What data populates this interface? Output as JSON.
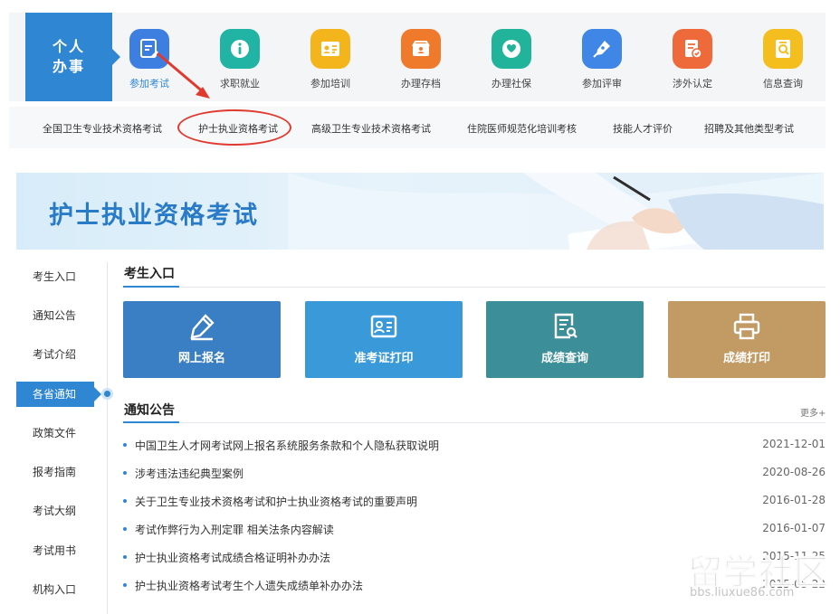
{
  "top_nav": {
    "personal_line1": "个人",
    "personal_line2": "办事",
    "items": [
      {
        "label": "参加考试",
        "icon": "pencil-card-icon",
        "color": "#3d7fe0"
      },
      {
        "label": "求职就业",
        "icon": "info-icon",
        "color": "#21b3a4"
      },
      {
        "label": "参加培训",
        "icon": "id-card-icon",
        "color": "#f3b41c"
      },
      {
        "label": "办理存档",
        "icon": "archive-icon",
        "color": "#f07a2b"
      },
      {
        "label": "办理社保",
        "icon": "heart-hand-icon",
        "color": "#22b39b"
      },
      {
        "label": "参加评审",
        "icon": "pen-icon",
        "color": "#3f86e6"
      },
      {
        "label": "涉外认定",
        "icon": "document-check-icon",
        "color": "#ef6a3a"
      },
      {
        "label": "信息查询",
        "icon": "search-doc-icon",
        "color": "#f5be1f"
      }
    ]
  },
  "sub_nav": {
    "items": [
      "全国卫生专业技术资格考试",
      "护士执业资格考试",
      "高级卫生专业技术资格考试",
      "住院医师规范化培训考核",
      "技能人才评价",
      "招聘及其他类型考试"
    ]
  },
  "banner": {
    "title": "护士执业资格考试"
  },
  "left_menu": {
    "items": [
      "考生入口",
      "通知公告",
      "考试介绍",
      "各省通知",
      "政策文件",
      "报考指南",
      "考试大纲",
      "考试用书",
      "机构入口"
    ]
  },
  "entry": {
    "title": "考生入口",
    "tiles": [
      {
        "label": "网上报名",
        "icon": "pencil-icon",
        "color": "#3a7ec4"
      },
      {
        "label": "准考证打印",
        "icon": "id-card-icon",
        "color": "#3a9ad9"
      },
      {
        "label": "成绩查询",
        "icon": "search-doc-icon",
        "color": "#3c8e99"
      },
      {
        "label": "成绩打印",
        "icon": "printer-icon",
        "color": "#c29a63"
      }
    ]
  },
  "notices": {
    "title": "通知公告",
    "more": "更多+",
    "rows": [
      {
        "title": "中国卫生人才网考试网上报名系统服务条款和个人隐私获取说明",
        "date": "2021-12-01"
      },
      {
        "title": "涉考违法违纪典型案例",
        "date": "2020-08-26"
      },
      {
        "title": "关于卫生专业技术资格考试和护士执业资格考试的重要声明",
        "date": "2016-01-28"
      },
      {
        "title": "考试作弊行为入刑定罪 相关法条内容解读",
        "date": "2016-01-07"
      },
      {
        "title": "护士执业资格考试成绩合格证明补办办法",
        "date": "2015-11-25"
      },
      {
        "title": "护士执业资格考试考生个人遗失成绩单补办办法",
        "date": "2015-05-22"
      }
    ]
  },
  "watermark": {
    "main": "留学社区",
    "sub": "bbs.liuxue86.com"
  }
}
